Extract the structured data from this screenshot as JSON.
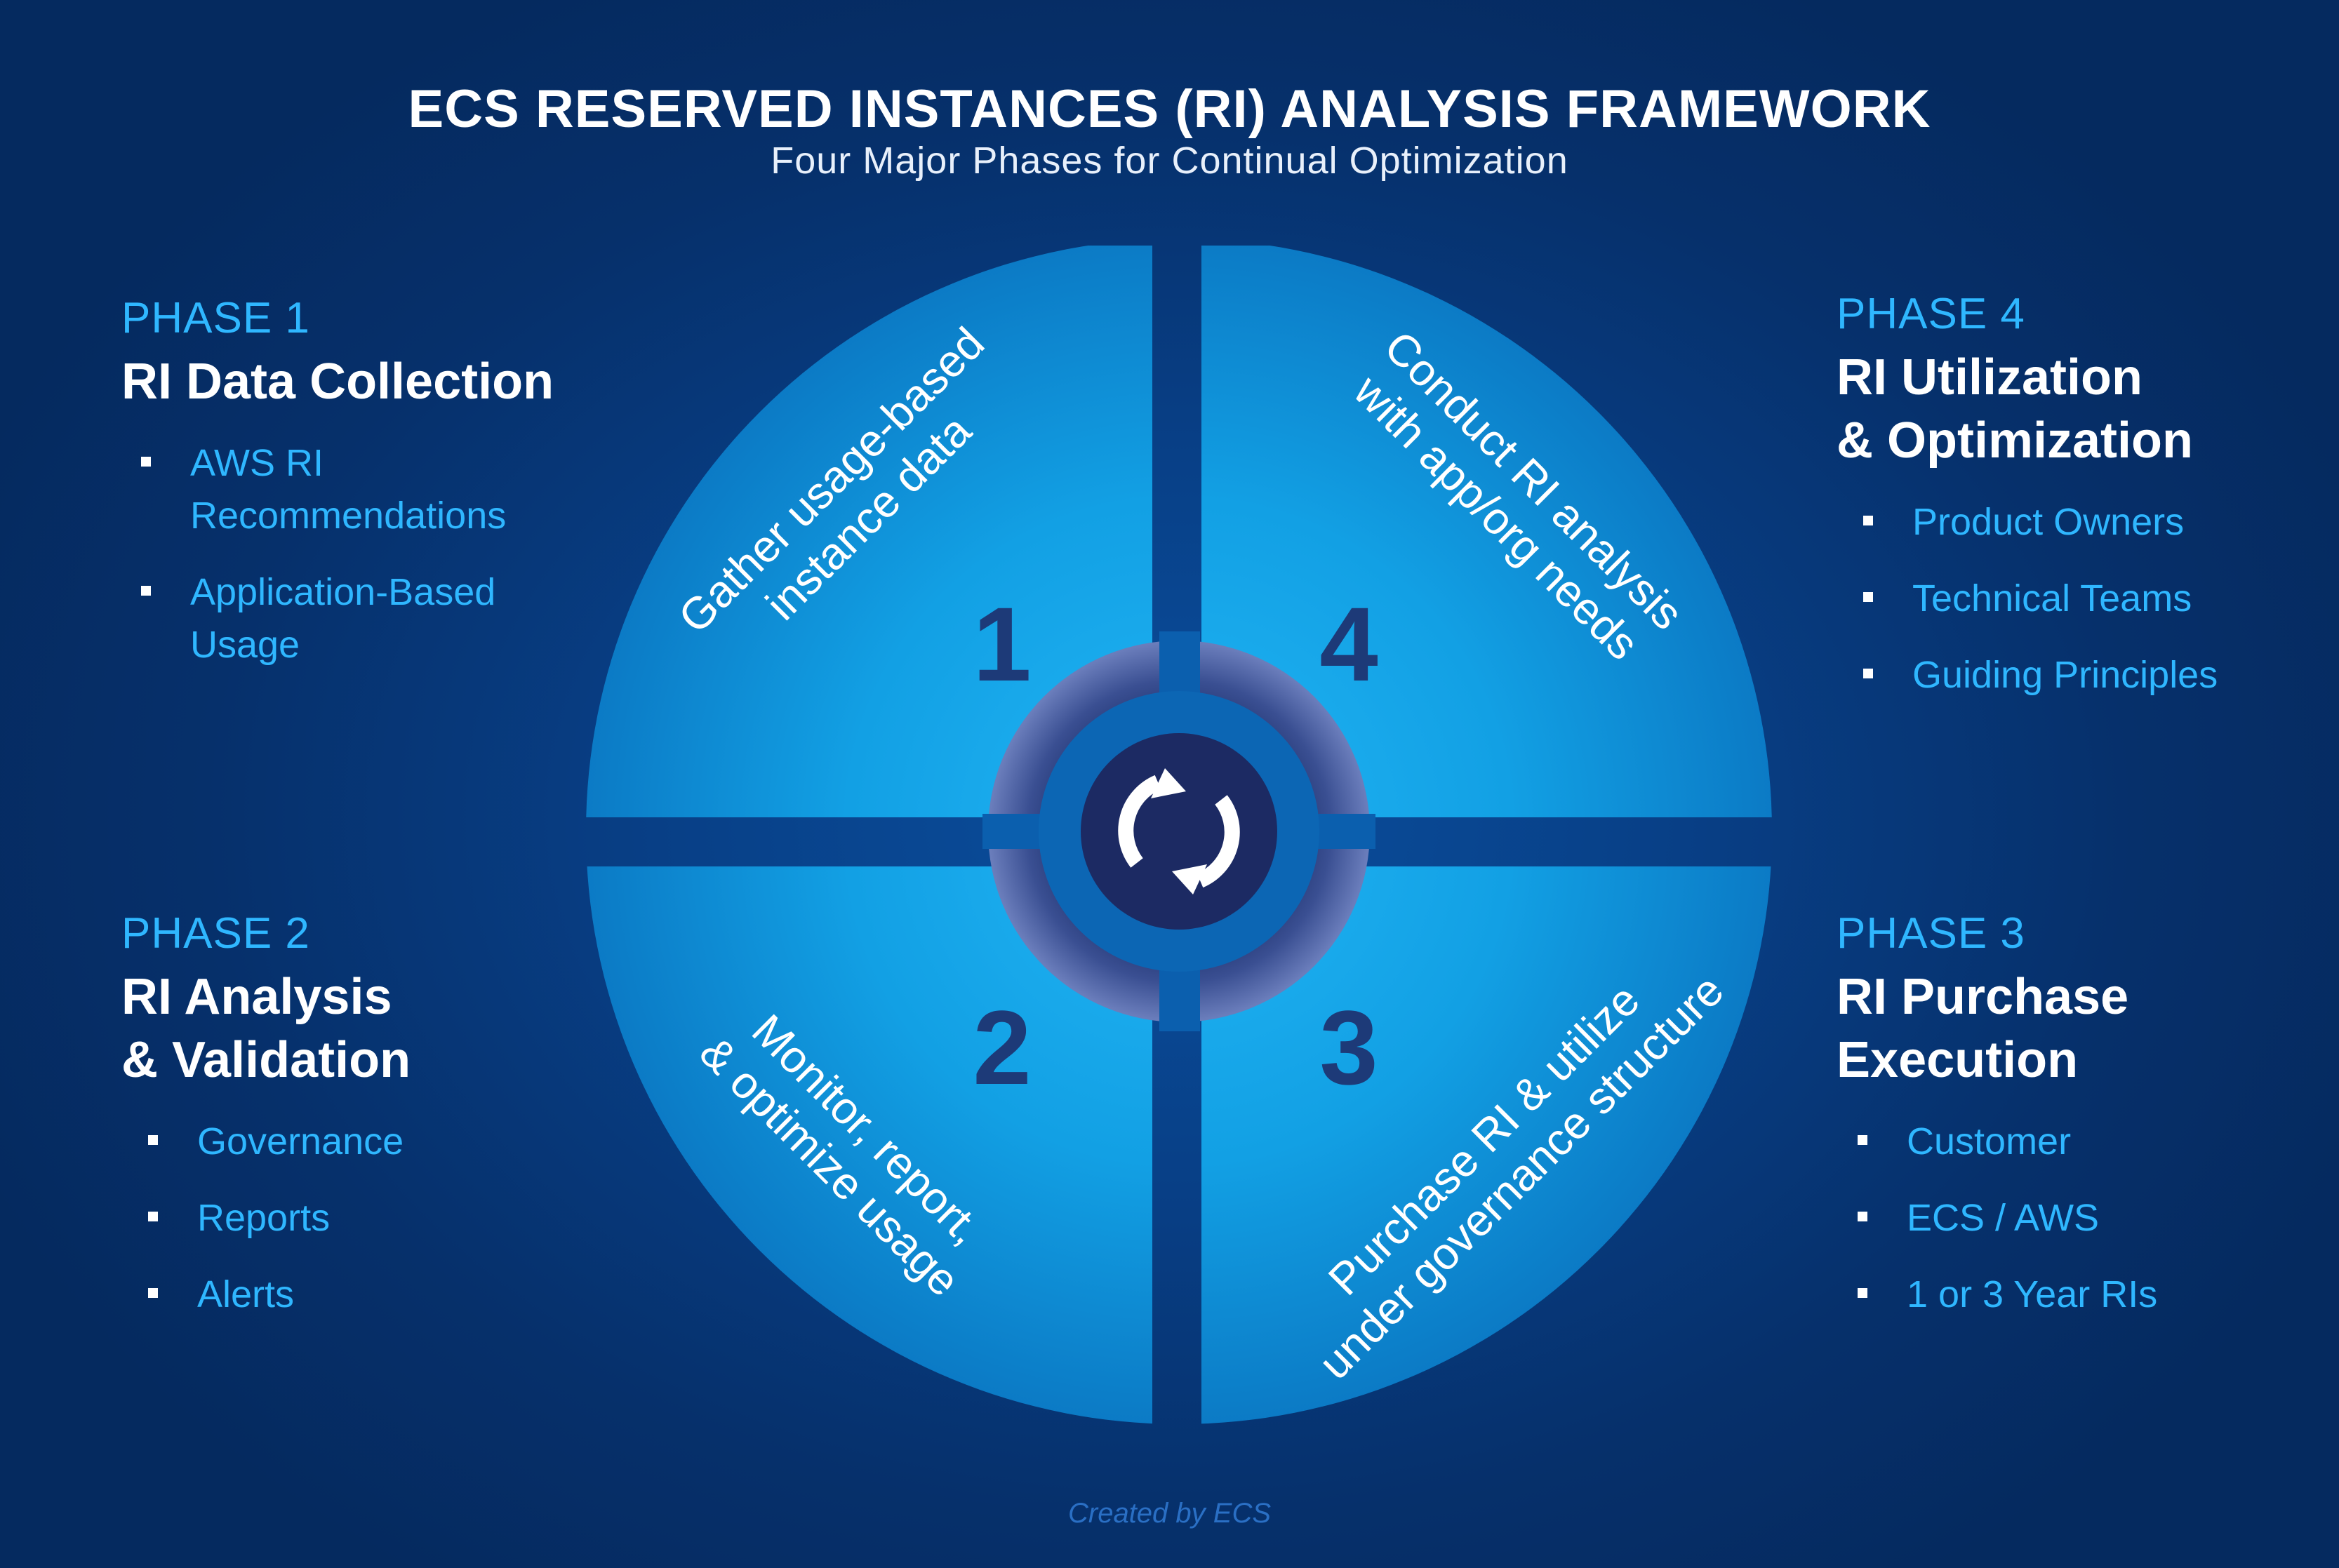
{
  "header": {
    "title": "ECS RESERVED INSTANCES (RI) ANALYSIS FRAMEWORK",
    "subtitle": "Four Major Phases for Continual Optimization"
  },
  "phases": [
    {
      "label": "PHASE 1",
      "title_lines": [
        "RI Data Collection"
      ],
      "items": [
        [
          "AWS RI",
          "Recommendations"
        ],
        [
          "Application-Based",
          "Usage"
        ]
      ]
    },
    {
      "label": "PHASE 2",
      "title_lines": [
        "RI Analysis",
        "& Validation"
      ],
      "items": [
        [
          "Governance"
        ],
        [
          "Reports"
        ],
        [
          "Alerts"
        ]
      ]
    },
    {
      "label": "PHASE 3",
      "title_lines": [
        "RI Purchase",
        "Execution"
      ],
      "items": [
        [
          "Customer"
        ],
        [
          "ECS / AWS"
        ],
        [
          "1 or 3 Year RIs"
        ]
      ]
    },
    {
      "label": "PHASE 4",
      "title_lines": [
        "RI Utilization",
        "& Optimization"
      ],
      "items": [
        [
          "Product Owners"
        ],
        [
          "Technical Teams"
        ],
        [
          "Guiding Principles"
        ]
      ]
    }
  ],
  "wheel": {
    "quadrants": [
      {
        "number": "1",
        "text": [
          "Gather usage-based",
          "instance data"
        ]
      },
      {
        "number": "4",
        "text": [
          "Conduct RI analysis",
          "with app/org needs"
        ]
      },
      {
        "number": "2",
        "text": [
          "Monitor, report,",
          "& optimize usage"
        ]
      },
      {
        "number": "3",
        "text": [
          "Purchase RI & utilize",
          "under governance structure"
        ]
      }
    ],
    "center_icon": "refresh-cycle-icon"
  },
  "colors": {
    "accent": "#2fb7ff",
    "quadrant_light": "#1aa6ea",
    "quadrant_dark": "#0b6fb8",
    "number": "#1d3a78"
  },
  "footer": "Created by ECS"
}
